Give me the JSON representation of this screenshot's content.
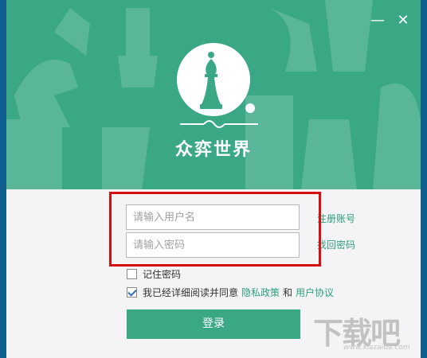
{
  "window": {
    "minimize_label": "—",
    "close_label": "✕"
  },
  "brand": {
    "app_name": "众弈世界",
    "logo_icon": "chess-bishop-icon",
    "accent_color": "#3aa884"
  },
  "login": {
    "username_placeholder": "请输入用户名",
    "password_placeholder": "请输入密码",
    "register_link": "注册账号",
    "recover_link": "找回密码",
    "remember_password_label": "记住密码",
    "remember_password_checked": false,
    "agree_prefix": "我已经详细阅读并同意",
    "privacy_link": "隐私政策",
    "agree_and": "和",
    "user_agreement_link": "用户协议",
    "agree_checked": true,
    "submit_label": "登录"
  },
  "watermark": {
    "main": "下载吧",
    "sub": "www.xiazaiba.com"
  }
}
